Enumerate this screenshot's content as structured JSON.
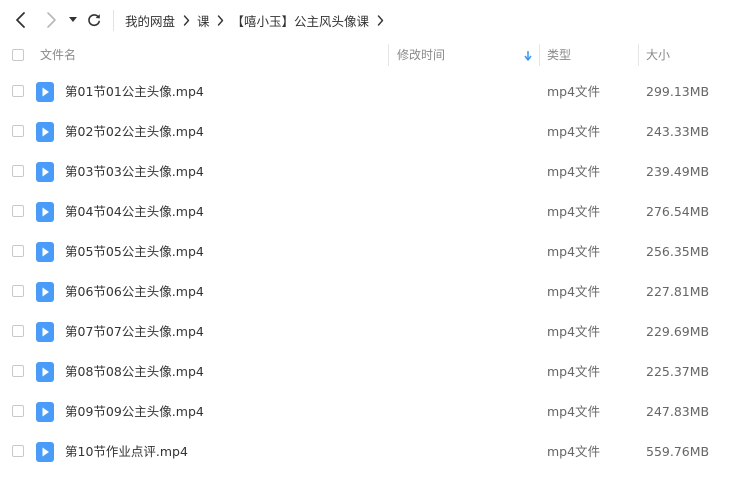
{
  "colors": {
    "accent": "#3b95f6",
    "icon": "#4a9cf8",
    "text": "#333333",
    "muted": "#8a8a8a"
  },
  "nav": {
    "back_icon": "chevron-left-icon",
    "forward_icon": "chevron-right-icon",
    "history_icon": "caret-down-icon",
    "refresh_icon": "refresh-icon"
  },
  "breadcrumb": {
    "items": [
      "我的网盘",
      "课",
      "【嘻小玉】公主风头像课"
    ],
    "separator_icon": "chevron-right-icon"
  },
  "columns": {
    "name": "文件名",
    "modified": "修改时间",
    "type": "类型",
    "size": "大小",
    "sort_icon": "arrow-down-icon"
  },
  "files": [
    {
      "name": "第01节01公主头像.mp4",
      "modified": "",
      "type": "mp4文件",
      "size": "299.13MB",
      "icon": "video-file-icon"
    },
    {
      "name": "第02节02公主头像.mp4",
      "modified": "",
      "type": "mp4文件",
      "size": "243.33MB",
      "icon": "video-file-icon"
    },
    {
      "name": "第03节03公主头像.mp4",
      "modified": "",
      "type": "mp4文件",
      "size": "239.49MB",
      "icon": "video-file-icon"
    },
    {
      "name": "第04节04公主头像.mp4",
      "modified": "",
      "type": "mp4文件",
      "size": "276.54MB",
      "icon": "video-file-icon"
    },
    {
      "name": "第05节05公主头像.mp4",
      "modified": "",
      "type": "mp4文件",
      "size": "256.35MB",
      "icon": "video-file-icon"
    },
    {
      "name": "第06节06公主头像.mp4",
      "modified": "",
      "type": "mp4文件",
      "size": "227.81MB",
      "icon": "video-file-icon"
    },
    {
      "name": "第07节07公主头像.mp4",
      "modified": "",
      "type": "mp4文件",
      "size": "229.69MB",
      "icon": "video-file-icon"
    },
    {
      "name": "第08节08公主头像.mp4",
      "modified": "",
      "type": "mp4文件",
      "size": "225.37MB",
      "icon": "video-file-icon"
    },
    {
      "name": "第09节09公主头像.mp4",
      "modified": "",
      "type": "mp4文件",
      "size": "247.83MB",
      "icon": "video-file-icon"
    },
    {
      "name": "第10节作业点评.mp4",
      "modified": "",
      "type": "mp4文件",
      "size": "559.76MB",
      "icon": "video-file-icon"
    }
  ]
}
